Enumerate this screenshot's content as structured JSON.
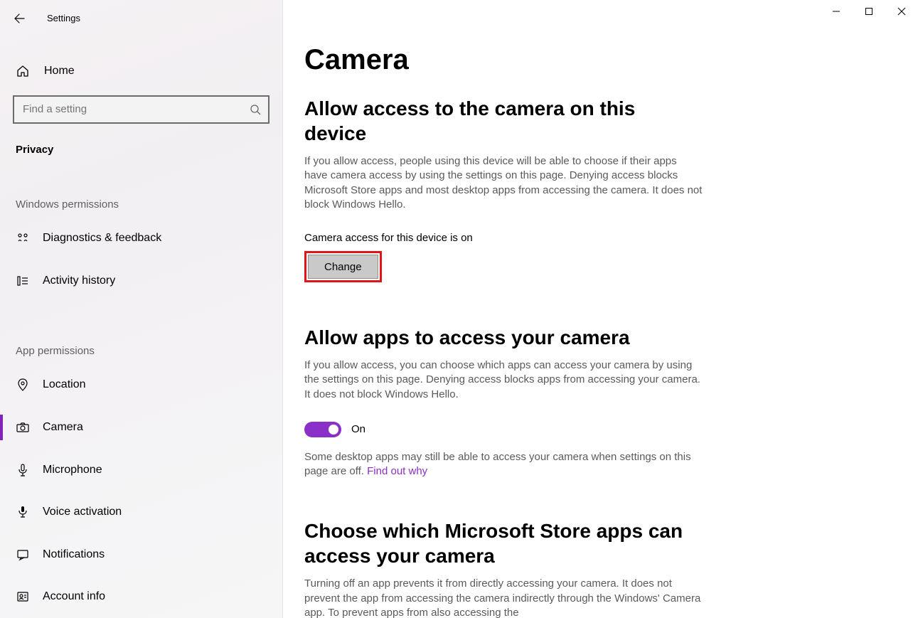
{
  "window": {
    "title": "Settings"
  },
  "sidebar": {
    "home": "Home",
    "search_placeholder": "Find a setting",
    "privacy_label": "Privacy",
    "group_windows": "Windows permissions",
    "group_app": "App permissions",
    "items_windows": [
      {
        "label": "Diagnostics & feedback"
      },
      {
        "label": "Activity history"
      }
    ],
    "items_app": [
      {
        "label": "Location"
      },
      {
        "label": "Camera"
      },
      {
        "label": "Microphone"
      },
      {
        "label": "Voice activation"
      },
      {
        "label": "Notifications"
      },
      {
        "label": "Account info"
      }
    ]
  },
  "main": {
    "page_title": "Camera",
    "section1": {
      "heading": "Allow access to the camera on this device",
      "desc": "If you allow access, people using this device will be able to choose if their apps have camera access by using the settings on this page. Denying access blocks Microsoft Store apps and most desktop apps from accessing the camera. It does not block Windows Hello.",
      "status": "Camera access for this device is on",
      "change_button": "Change"
    },
    "section2": {
      "heading": "Allow apps to access your camera",
      "desc": "If you allow access, you can choose which apps can access your camera by using the settings on this page. Denying access blocks apps from accessing your camera. It does not block Windows Hello.",
      "toggle_label": "On",
      "note_prefix": "Some desktop apps may still be able to access your camera when settings on this page are off. ",
      "note_link": "Find out why"
    },
    "section3": {
      "heading": "Choose which Microsoft Store apps can access your camera",
      "desc": "Turning off an app prevents it from directly accessing your camera. It does not prevent the app from accessing the camera indirectly through the Windows' Camera app. To prevent apps from also accessing the"
    }
  }
}
